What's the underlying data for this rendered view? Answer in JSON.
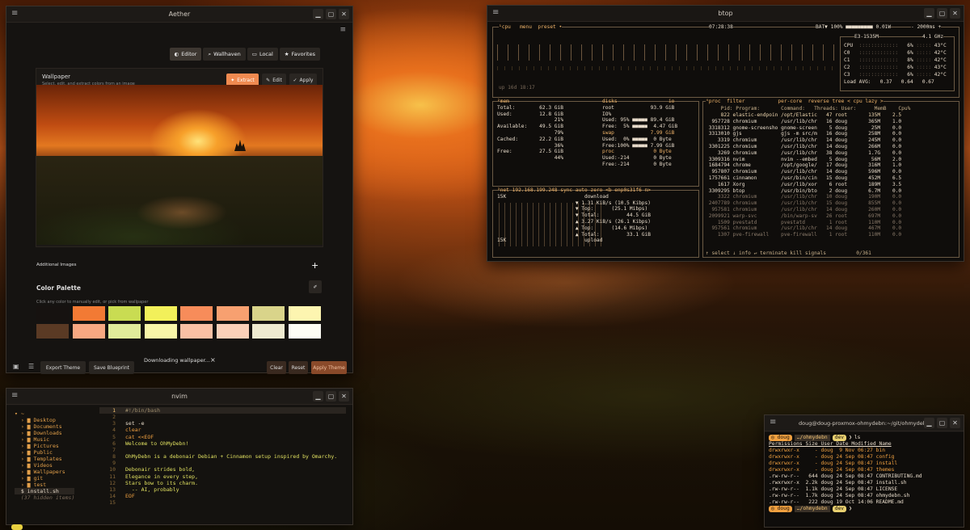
{
  "aether": {
    "title": "Aether",
    "tabs": [
      {
        "label": "Editor",
        "icon": "palette-icon"
      },
      {
        "label": "Wallhaven",
        "icon": "search-icon"
      },
      {
        "label": "Local",
        "icon": "folder-icon"
      },
      {
        "label": "Favorites",
        "icon": "star-icon"
      }
    ],
    "wallpaper_title": "Wallpaper",
    "wallpaper_sub": "Select, edit, and extract colors from an image",
    "extract_label": "Extract",
    "edit_label": "Edit",
    "apply_label": "Apply",
    "additional_images": "Additional Images",
    "add_symbol": "+",
    "palette_title": "Color Palette",
    "palette_sub": "Click any color to manually edit, or pick from wallpaper",
    "palette_row1": [
      "#161210",
      "#f27a34",
      "#c9dc52",
      "#f2f05a",
      "#f78c5a",
      "#f7a070",
      "#d9d48a",
      "#fdf5b0"
    ],
    "palette_row2": [
      "#5a3a24",
      "#f7a882",
      "#e0ec9a",
      "#f7f5a8",
      "#fac0a4",
      "#fbd0b8",
      "#eeead0",
      "#fdfdf5"
    ],
    "export_label": "Export Theme",
    "blueprint_label": "Save Blueprint",
    "toast": "Downloading wallpaper...",
    "toast_close": "×",
    "clear_label": "Clear",
    "reset_label": "Reset",
    "apply_theme_label": "Apply Theme"
  },
  "btop": {
    "title": "btop",
    "cpu_header": "¹cpu   menu  preset •",
    "clock": "07:28:38",
    "battery": "BAT▼ 100% ■■■■■■■■■ 0.01W",
    "interval": "- 2000ms +",
    "uptime": "up 16d 18:17",
    "cpu_model": "E3-1535M",
    "cpu_freq": "4.1 GHz",
    "cpu_rows": [
      {
        "name": "CPU",
        "pct": "6%",
        "temp": "43°C"
      },
      {
        "name": "C0",
        "pct": "6%",
        "temp": "42°C"
      },
      {
        "name": "C1",
        "pct": "8%",
        "temp": "42°C"
      },
      {
        "name": "C2",
        "pct": "6%",
        "temp": "43°C"
      },
      {
        "name": "C3",
        "pct": "6%",
        "temp": "42°C"
      }
    ],
    "load_avg": "Load AVG:   0.37   0.64   0.67",
    "mem_lines": [
      "²mem",
      "Total:        62.3 GiB",
      "Used:         12.8 GiB",
      "                   21%",
      "Available:    49.5 GiB",
      "                   79%",
      "Cached:       22.2 GiB",
      "                   36%",
      "Free:         27.5 GiB",
      "                   44%"
    ],
    "disk_lines": [
      "disks                 io",
      "root            93.9 GiB",
      "IO%",
      "Used: 95% ■■■■■ 89.4 GiB",
      "Free:  5% ■■■■■  4.47 GiB",
      "swap            7.99 GiB",
      "Used:  0% ■■■■■  0 Byte",
      "Free:100% ■■■■■ 7.99 GiB",
      "proc             0 Byte",
      "Used:-214        0 Byte",
      "Free:-214        0 Byte"
    ],
    "net_lines": [
      "³net 192.168.199.248 sync auto zero <b enp0s31f6 n>",
      "15K                          download",
      "                          ▼ 1.31 KiB/s (10.5 Kibps)",
      "                          ▼ Top:      (25.1 Mibps)",
      "                          ▼ Total:         44.5 GiB",
      "                          ▲ 3.27 KiB/s (26.1 Kibps)",
      "                          ▲ Top:      (14.6 Mibps)",
      "                          ▲ Total:         33.1 GiB",
      "15K                          upload"
    ],
    "proc_header": "⁴proc  filter           per-core  reverse tree < cpu lazy >",
    "proc_cols": "     Pid: Program:       Command:   Threads: User:      MemB    Cpu%",
    "procs": [
      "     822 elastic-endpoin /opt/Elastic   47 root       135M    2.5",
      "  957728 chromium        /usr/lib/chr   16 doug       365M    1.0",
      " 3318312 gnome-screensho gnome-screen    5 doug        25M    0.0",
      " 3313010 gjs             gjs -m src/m   16 doug       258M    0.0",
      "    3319 chromium        /usr/lib/chr   14 doug       245M    0.0",
      " 3301225 chromium        /usr/lib/chr   14 doug       266M    0.0",
      "    3269 chromium        /usr/lib/chr   38 doug       1.7G    0.0",
      " 3309316 nvim            nvim --embed    5 doug        56M    2.0",
      " 1684794 chrome          /opt/google/   17 doug       316M    1.0",
      "  957807 chromium        /usr/lib/chr   14 doug       596M    0.0",
      " 1757661 cinnamon        /usr/bin/cin   15 doug       452M    6.5",
      "    1617 Xorg            /usr/lib/xor    6 root       189M    3.5",
      " 3309295 btop            /usr/bin/bto    2 doug       6.7M    0.0",
      "    3322 chromium        /usr/lib/chr   10 doug       190M    0.0",
      " 2407789 chromium        /usr/lib/chr   15 doug       855M    0.0",
      "  957581 chromium        /usr/lib/chr   14 doug       260M    0.0",
      " 2099921 warp-svc        /bin/warp-sv   26 root       697M    0.0",
      "    1509 pvestatd        pvestatd        1 root       110M    0.0",
      "  957561 chromium        /usr/lib/chr   14 doug       467M    0.0",
      "    1307 pve-firewall    pve-firewall    1 root       110M    0.0"
    ],
    "proc_footer": "↑ select ↓ info ↵ terminate kill signals          0/361"
  },
  "nvim": {
    "title": "nvim",
    "tree_root": "▾ ~",
    "tree": [
      {
        "label": "Desktop",
        "dir": true
      },
      {
        "label": "Documents",
        "dir": true
      },
      {
        "label": "Downloads",
        "dir": true
      },
      {
        "label": "Music",
        "dir": true
      },
      {
        "label": "Pictures",
        "dir": true
      },
      {
        "label": "Public",
        "dir": true
      },
      {
        "label": "Templates",
        "dir": true
      },
      {
        "label": "Videos",
        "dir": true
      },
      {
        "label": "Wallpapers",
        "dir": true
      },
      {
        "label": "git",
        "dir": true
      },
      {
        "label": "test",
        "dir": true
      },
      {
        "label": "install.sh",
        "dir": false
      }
    ],
    "hidden": "(37 hidden items)",
    "lines": [
      {
        "n": "1",
        "t": "#!/bin/bash",
        "c": "#9a8a6a"
      },
      {
        "n": "2",
        "t": "",
        "c": "#e8dccb"
      },
      {
        "n": "3",
        "t": "set -e",
        "c": "#e8dccb"
      },
      {
        "n": "4",
        "t": "clear",
        "c": "#f0a040"
      },
      {
        "n": "5",
        "t": "cat <<EOF",
        "c": "#f0a040"
      },
      {
        "n": "6",
        "t": "Welcome to OhMyDebn!",
        "c": "#e0e060"
      },
      {
        "n": "7",
        "t": "",
        "c": "#e8dccb"
      },
      {
        "n": "8",
        "t": "OhMyDebn is a debonair Debian + Cinnamon setup inspired by Omarchy.",
        "c": "#e0e060"
      },
      {
        "n": "9",
        "t": "",
        "c": "#e8dccb"
      },
      {
        "n": "10",
        "t": "Debonair strides bold,",
        "c": "#e0e060"
      },
      {
        "n": "11",
        "t": "Elegance in every step,",
        "c": "#e0e060"
      },
      {
        "n": "12",
        "t": "Stars bow to its charm.",
        "c": "#e0e060"
      },
      {
        "n": "13",
        "t": "  -- AI, probably",
        "c": "#e0e060"
      },
      {
        "n": "14",
        "t": "EOF",
        "c": "#f0a040"
      },
      {
        "n": "15",
        "t": "",
        "c": "#e8dccb"
      }
    ]
  },
  "terminal": {
    "title": "doug@doug-proxmox-ohmydebn:~/git/ohmydebn",
    "user": "doug",
    "path": "…/ohmydebn",
    "branch": "dev",
    "cmd": "ls",
    "header": "Permissions Size User Date Modified Name",
    "rows": [
      "drwxrwxr-x     - doug  9 Nov 06:27 bin",
      "drwxrwxr-x     - doug 24 Sep 08:47 config",
      "drwxrwxr-x     - doug 24 Sep 08:47 install",
      "drwxrwxr-x     - doug 24 Sep 08:47 themes",
      ".rw-rw-r--   644 doug 24 Sep 08:47 CONTRIBUTING.md",
      ".rwxrwxr-x  2.2k doug 24 Sep 08:47 install.sh",
      ".rw-rw-r--  1.1k doug 24 Sep 08:47 LICENSE",
      ".rw-rw-r--  1.7k doug 24 Sep 08:47 ohmydebn.sh",
      ".rw-rw-r--   222 doug 19 Oct 14:06 README.md"
    ]
  }
}
